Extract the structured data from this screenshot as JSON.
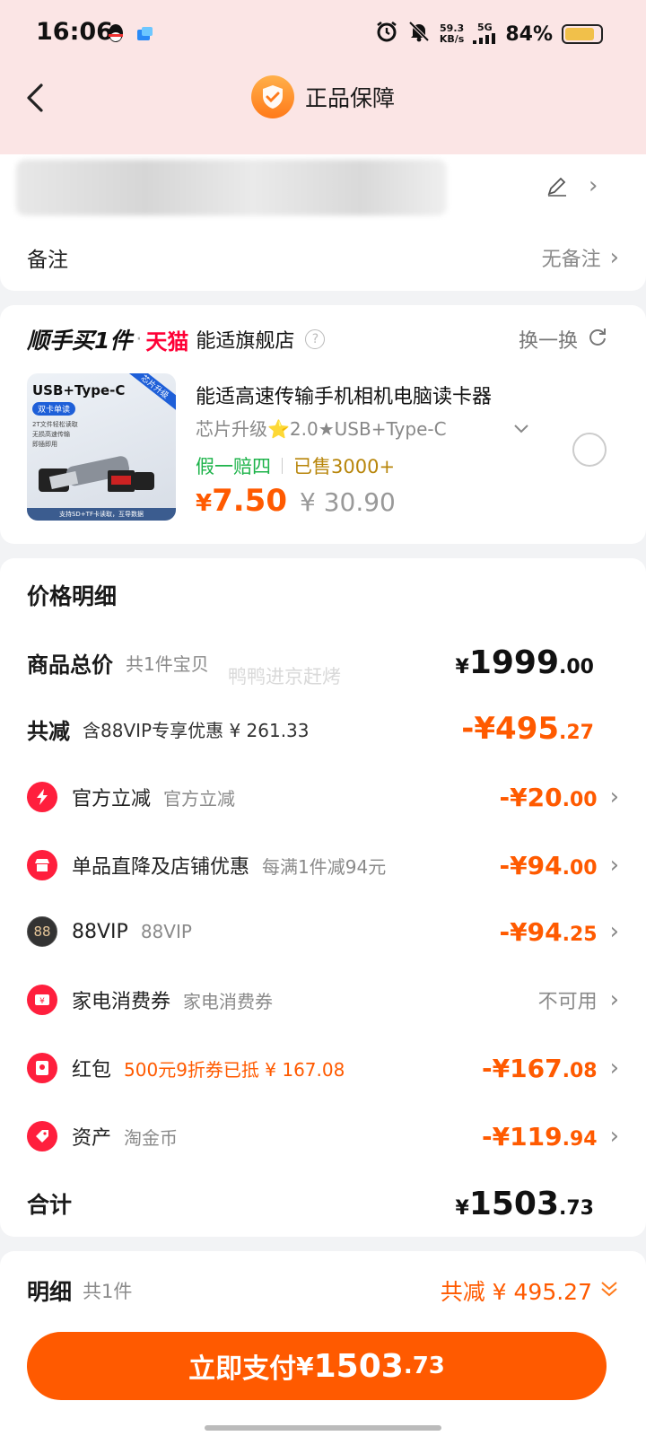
{
  "status": {
    "time": "16:06",
    "net_speed": "59.3",
    "net_unit": "KB/s",
    "signal": "5G",
    "battery": "84%"
  },
  "header": {
    "title": "正品保障"
  },
  "remark": {
    "label": "备注",
    "value": "无备注"
  },
  "store": {
    "brand": "顺手买1件",
    "platform": "天猫",
    "name": "能适旗舰店",
    "swap": "换一换"
  },
  "product": {
    "image_title": "USB+Type-C",
    "image_corner": "芯片升级",
    "image_tag": "双卡单读",
    "image_lines": [
      "2T文件轻松读取",
      "无损高速传输",
      "即插即用"
    ],
    "image_footer": "支持SD+TF卡读取，互导数据",
    "title": "能适高速传输手机相机电脑读卡器",
    "spec": "芯片升级⭐2.0★USB+Type-C",
    "tag_guarantee": "假一赔四",
    "sold": "已售3000+",
    "price_symbol": "¥",
    "price": "7.50",
    "original_price": "¥ 30.90"
  },
  "detail": {
    "title": "价格明细",
    "watermark": "鸭鸭进京赶烤",
    "total_label": "商品总价",
    "total_sub": "共1件宝贝",
    "total_sym": "¥",
    "total_int": "1999",
    "total_dec": ".00",
    "reduce_label": "共减",
    "reduce_sub": "含88VIP专享优惠 ¥ 261.33",
    "reduce_int": "-¥495",
    "reduce_dec": ".27",
    "items": [
      {
        "label": "官方立减",
        "sub": "官方立减",
        "int": "-¥20",
        "dec": ".00"
      },
      {
        "label": "单品直降及店铺优惠",
        "sub": "每满1件减94元",
        "int": "-¥94",
        "dec": ".00"
      },
      {
        "label": "88VIP",
        "sub": "88VIP",
        "int": "-¥94",
        "dec": ".25",
        "icon_text": "88"
      },
      {
        "label": "家电消费券",
        "sub": "家电消费券",
        "value": "不可用"
      },
      {
        "label": "红包",
        "sub": "500元9折券已抵 ¥ 167.08",
        "int": "-¥167",
        "dec": ".08"
      },
      {
        "label": "资产",
        "sub": "淘金币",
        "int": "-¥119",
        "dec": ".94"
      }
    ],
    "sum_label": "合计",
    "sum_sym": "¥",
    "sum_int": "1503",
    "sum_dec": ".73"
  },
  "footer": {
    "label": "明细",
    "count": "共1件",
    "reduce": "共减 ¥ 495.27",
    "pay_label": "立即支付",
    "pay_sym": "¥",
    "pay_int": "1503",
    "pay_dec": ".73"
  },
  "colors": {
    "accent": "#ff5a00",
    "header_bg": "#fbe5e5",
    "tmall_red": "#ff0036",
    "green": "#1db34a"
  }
}
